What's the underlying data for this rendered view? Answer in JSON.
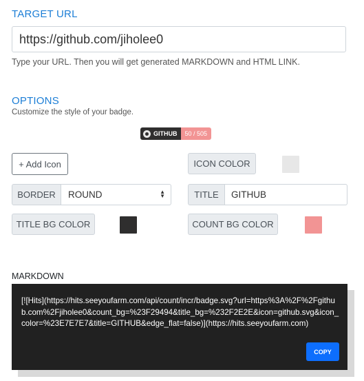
{
  "target_url": {
    "title": "TARGET URL",
    "input_value": "https://github.com/jiholee0",
    "help_text": "Type your URL. Then you will get generated MARKDOWN and HTML LINK."
  },
  "options": {
    "title": "OPTIONS",
    "subtitle": "Customize the style of your badge.",
    "badge_preview": {
      "label": "GITHUB",
      "count": "50 / 505",
      "title_bg": "#2F2E2E",
      "count_bg": "#F29494"
    },
    "add_icon_label": "+ Add Icon",
    "icon_color_label": "ICON COLOR",
    "icon_color": "#E7E7E7",
    "border_label": "BORDER",
    "border_value": "ROUND",
    "title_label": "TITLE",
    "title_value": "GITHUB",
    "title_bg_label": "TITLE BG COLOR",
    "title_bg_color": "#2F2E2E",
    "count_bg_label": "COUNT BG COLOR",
    "count_bg_color": "#F29494"
  },
  "markdown": {
    "title": "MARKDOWN",
    "code": "[![Hits](https://hits.seeyoufarm.com/api/count/incr/badge.svg?url=https%3A%2F%2Fgithub.com%2Fjiholee0&count_bg=%23F29494&title_bg=%232F2E2E&icon=github.svg&icon_color=%23E7E7E7&title=GITHUB&edge_flat=false)](https://hits.seeyoufarm.com)",
    "copy_label": "COPY"
  }
}
